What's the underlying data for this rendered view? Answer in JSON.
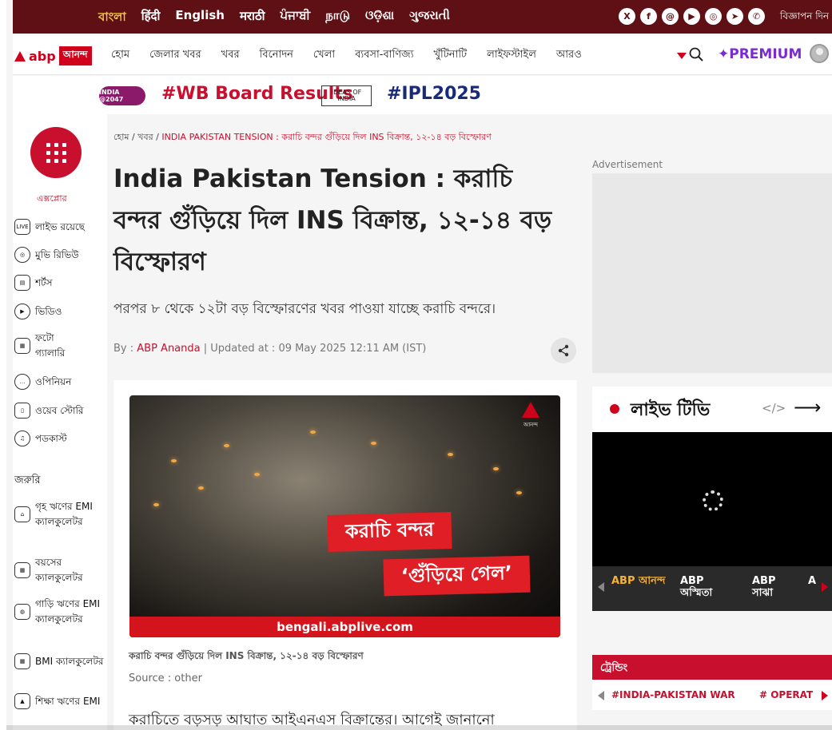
{
  "langbar": {
    "languages": [
      "বাংলা",
      "हिंदी",
      "English",
      "मराठी",
      "ਪੰਜਾਬੀ",
      "நாடு",
      "ଓଡ଼ିଶା",
      "ગુજરાતી"
    ],
    "socials": [
      "X",
      "f",
      "@",
      "▶",
      "◎",
      "➤",
      "✆"
    ],
    "advertise": "বিজ্ঞাপন দিন"
  },
  "nav": {
    "logo_abp": "abp",
    "logo_box": "আনন্দ",
    "items": [
      "হোম",
      "জেলার খবর",
      "খবর",
      "বিনোদন",
      "খেলা",
      "ব্যবসা-বাণিজ্য",
      "খুঁটিনাটি",
      "লাইফস্টাইল",
      "আরও"
    ],
    "premium": "✦PREMIUM"
  },
  "topics": {
    "india_badge": "INDIA @2047",
    "wb": "#WB Board Results",
    "ideas": "IDEAS OF INDIA",
    "ipl": "#IPL2025"
  },
  "sidebar": {
    "explore": "এক্সপ্লোর",
    "items": [
      {
        "label": "লাইভ রয়েছে",
        "icon": "LIVE"
      },
      {
        "label": "মুভি রিভিউ",
        "icon": "◎"
      },
      {
        "label": "শর্টস",
        "icon": "▤"
      },
      {
        "label": "ভিডিও",
        "icon": "▶"
      },
      {
        "label": "ফটো গ্যালারি",
        "icon": "▦"
      },
      {
        "label": "ওপিনিয়ন",
        "icon": "…"
      },
      {
        "label": "ওয়েব স্টোরি",
        "icon": "▯"
      },
      {
        "label": "পডকাস্ট",
        "icon": "♫"
      }
    ],
    "heading": "জরুরি",
    "tools": [
      {
        "label": "গৃহ ঋণের EMI ক্যালকুলেটর",
        "icon": "⌂"
      },
      {
        "label": "বয়সের ক্যালকুলেটর",
        "icon": "▦"
      },
      {
        "label": "গাড়ি ঋণের EMI ক্যালকুলেটর",
        "icon": "◍"
      },
      {
        "label": "BMI ক্যালকুলেটর",
        "icon": "▦"
      },
      {
        "label": "শিক্ষা ঋণের EMI",
        "icon": "▲"
      }
    ]
  },
  "article": {
    "breadcrumb_home": "হোম",
    "breadcrumb_news": "খবর",
    "breadcrumb_current": "INDIA PAKISTAN TENSION : করাচি বন্দর গুঁড়িয়ে দিল INS বিক্রান্ত, ১২-১৪ বড় বিস্ফোরণ",
    "headline": "India Pakistan Tension : করাচি বন্দর গুঁড়িয়ে দিল INS বিক্রান্ত, ১২-১৪ বড় বিস্ফোরণ",
    "subhead": "পরপর ৮ থেকে ১২টা বড় বিস্ফোরণের খবর পাওয়া যাচ্ছে করাচি বন্দরে।",
    "by_label": "By :",
    "author": "ABP Ananda",
    "updated": "Updated at : 09 May 2025 12:11 AM (IST)",
    "hero_logo_text": "আনন্দ",
    "hero_caption_1": "করাচি বন্দর",
    "hero_caption_2": "‘গুঁড়িয়ে গেল’",
    "hero_url": "bengali.abplive.com",
    "image_caption": "করাচি বন্দর গুঁড়িয়ে দিল INS বিক্রান্ত, ১২-১৪ বড় বিস্ফোরণ",
    "source": "Source : other",
    "body": "করাচিতে বড়সড় আঘাত আইএনএস বিক্রান্তের। আগেই জানানো"
  },
  "right": {
    "ad_label": "Advertisement",
    "live_title": "লাইভ টিভি",
    "embed": "</>",
    "arrow": "⟶",
    "channels": [
      {
        "label": "ABP আনন্দ",
        "active": true
      },
      {
        "label": "ABP অস্মিতা",
        "active": false
      },
      {
        "label": "ABP সাঝা",
        "active": false
      },
      {
        "label": "A",
        "active": false
      }
    ],
    "trending_title": "ট্রেন্ডিং",
    "trending_tags": [
      "#INDIA-PAKISTAN WAR",
      "# OPERAT"
    ]
  },
  "colors": {
    "brand_red": "#d0021b",
    "langbar_bg": "#5e1014",
    "premium": "#7a2bd1",
    "ipl_blue": "#1a2a7a"
  }
}
